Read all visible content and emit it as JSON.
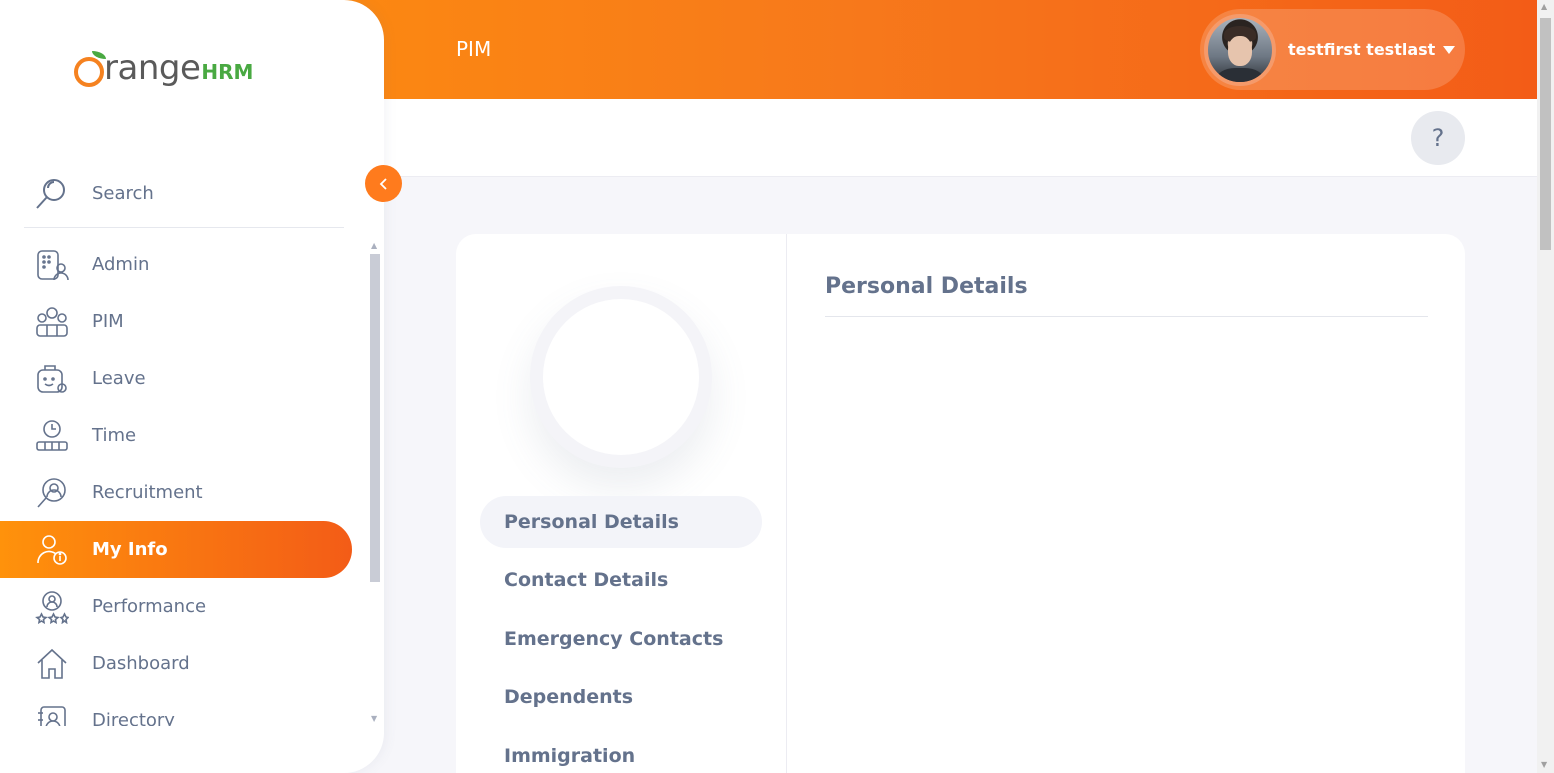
{
  "header": {
    "module_title": "PIM",
    "user_name": "testfirst testlast"
  },
  "help": {
    "label": "?"
  },
  "brand": {
    "part1": "range",
    "part2": "HRM"
  },
  "sidebar": {
    "search_label": "Search",
    "collapse_icon": "chevron-left-icon",
    "items": [
      {
        "label": "Admin",
        "icon": "admin-icon",
        "active": false
      },
      {
        "label": "PIM",
        "icon": "pim-icon",
        "active": false
      },
      {
        "label": "Leave",
        "icon": "leave-icon",
        "active": false
      },
      {
        "label": "Time",
        "icon": "time-icon",
        "active": false
      },
      {
        "label": "Recruitment",
        "icon": "recruitment-icon",
        "active": false
      },
      {
        "label": "My Info",
        "icon": "my-info-icon",
        "active": true
      },
      {
        "label": "Performance",
        "icon": "performance-icon",
        "active": false
      },
      {
        "label": "Dashboard",
        "icon": "dashboard-icon",
        "active": false
      },
      {
        "label": "Directory",
        "icon": "directory-icon",
        "active": false
      }
    ]
  },
  "profile_tabs": [
    {
      "label": "Personal Details",
      "active": true
    },
    {
      "label": "Contact Details",
      "active": false
    },
    {
      "label": "Emergency Contacts",
      "active": false
    },
    {
      "label": "Dependents",
      "active": false
    },
    {
      "label": "Immigration",
      "active": false
    }
  ],
  "main": {
    "section_title": "Personal Details"
  },
  "colors": {
    "accent": "#ff7b1d",
    "gradient_start": "#ff920b",
    "gradient_end": "#f35c17",
    "text": "#64728c"
  }
}
